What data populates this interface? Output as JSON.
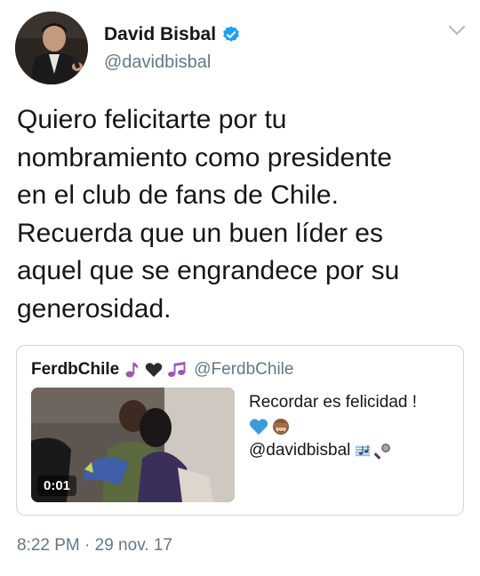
{
  "author": {
    "display_name": "David Bisbal",
    "handle": "@davidbisbal",
    "verified": true,
    "icons": [
      "avatar-photo",
      "verified-badge-icon",
      "chevron-down-icon"
    ]
  },
  "tweet": {
    "text": "Quiero felicitarte por tu\nnombramiento como presidente\nen el club de fans de Chile.\nRecuerda que un buen líder es\naquel que se engrandece por su\ngenerosidad.",
    "timestamp": "8:22 PM · 29 nov. 17"
  },
  "quoted_tweet": {
    "display_name": "FerdbChile",
    "handle": "@FerdbChile",
    "name_emoji": [
      "music-note-icon",
      "black-heart-icon",
      "music-notes-icon"
    ],
    "line1": "Recordar es felicidad !",
    "line2_emoji": [
      "blue-heart-icon",
      "see-no-evil-monkey-icon"
    ],
    "line3": "@davidbisbal",
    "line3_emoji": [
      "musical-score-icon",
      "microphone-icon"
    ],
    "video_duration": "0:01"
  },
  "colors": {
    "text": "#14171a",
    "secondary": "#657786",
    "verified": "#1da1f2",
    "border": "#ccd6dd"
  }
}
